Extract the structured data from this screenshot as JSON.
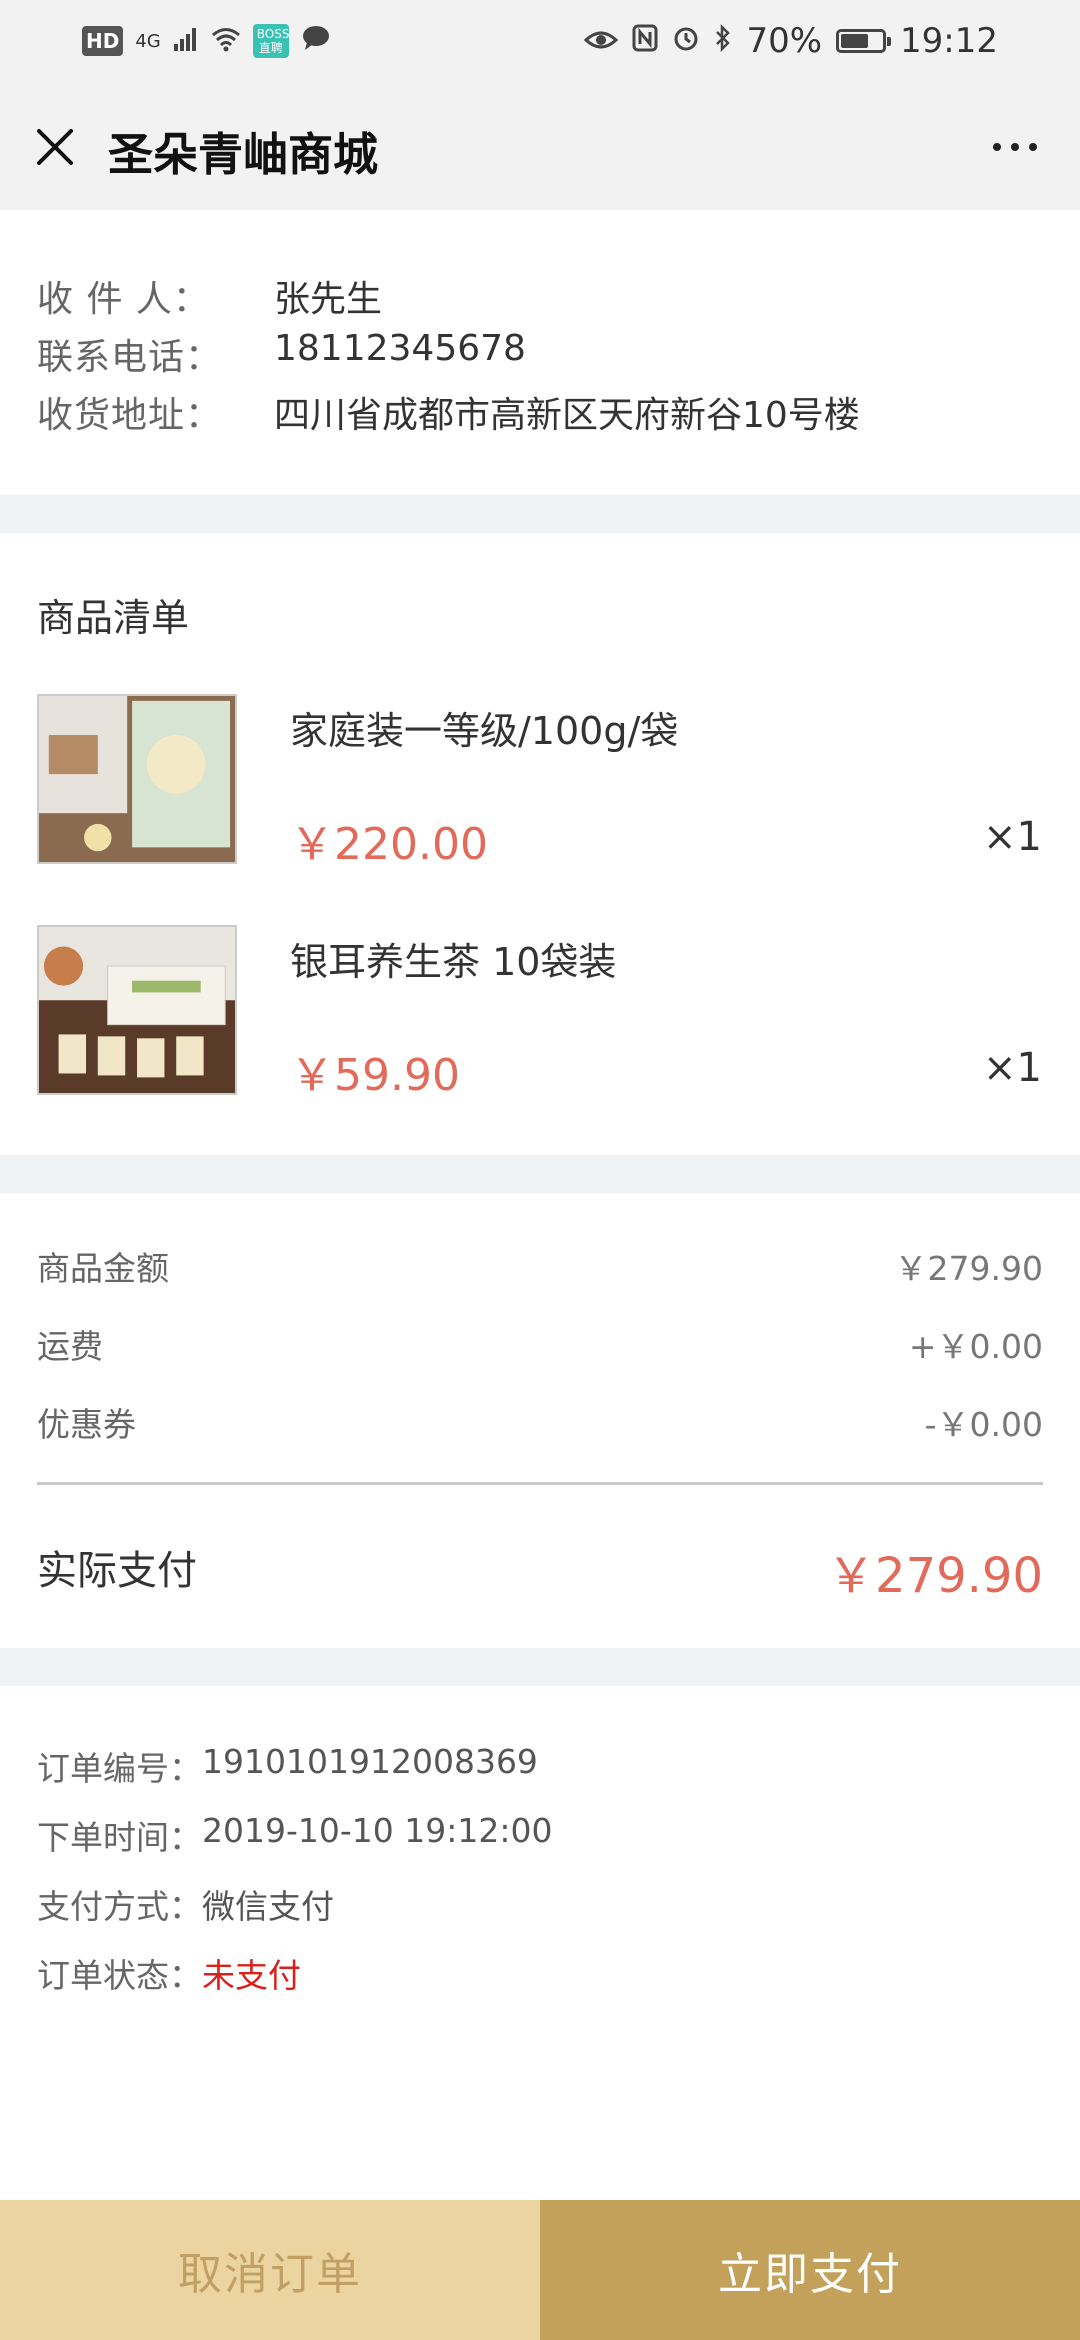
{
  "status_bar": {
    "hd": "HD",
    "network": "4G",
    "boss_badge": "BOSS直聘",
    "battery_text": "70%",
    "battery_level": 0.7,
    "time": "19:12"
  },
  "header": {
    "title": "圣朵青岫商城"
  },
  "address": {
    "recipient_label": "收 件 人：",
    "recipient_value": "张先生",
    "phone_label": "联系电话：",
    "phone_value": "18112345678",
    "address_label": "收货地址：",
    "address_value": "四川省成都市高新区天府新谷10号楼"
  },
  "product_list": {
    "title": "商品清单",
    "items": [
      {
        "name": "家庭装一等级/100g/袋",
        "price": "￥220.00",
        "qty": "×1"
      },
      {
        "name": "银耳养生茶 10袋装",
        "price": "￥59.90",
        "qty": "×1"
      }
    ]
  },
  "summary": {
    "goods_label": "商品金额",
    "goods_value": "￥279.90",
    "shipping_label": "运费",
    "shipping_value": "+￥0.00",
    "coupon_label": "优惠券",
    "coupon_value": "-￥0.00",
    "pay_label": "实际支付",
    "pay_value": "￥279.90"
  },
  "order_info": {
    "number_label": "订单编号：",
    "number_value": "1910101912008369",
    "time_label": "下单时间：",
    "time_value": "2019-10-10 19:12:00",
    "method_label": "支付方式：",
    "method_value": "微信支付",
    "status_label": "订单状态：",
    "status_value": "未支付"
  },
  "actions": {
    "cancel_label": "取消订单",
    "pay_label": "立即支付"
  },
  "colors": {
    "price_red": "#e16a5a",
    "status_red": "#d9201a",
    "cancel_bg": "#ecd4a1",
    "pay_bg": "#c3a15a",
    "divider_gap": "#eff3f6"
  }
}
